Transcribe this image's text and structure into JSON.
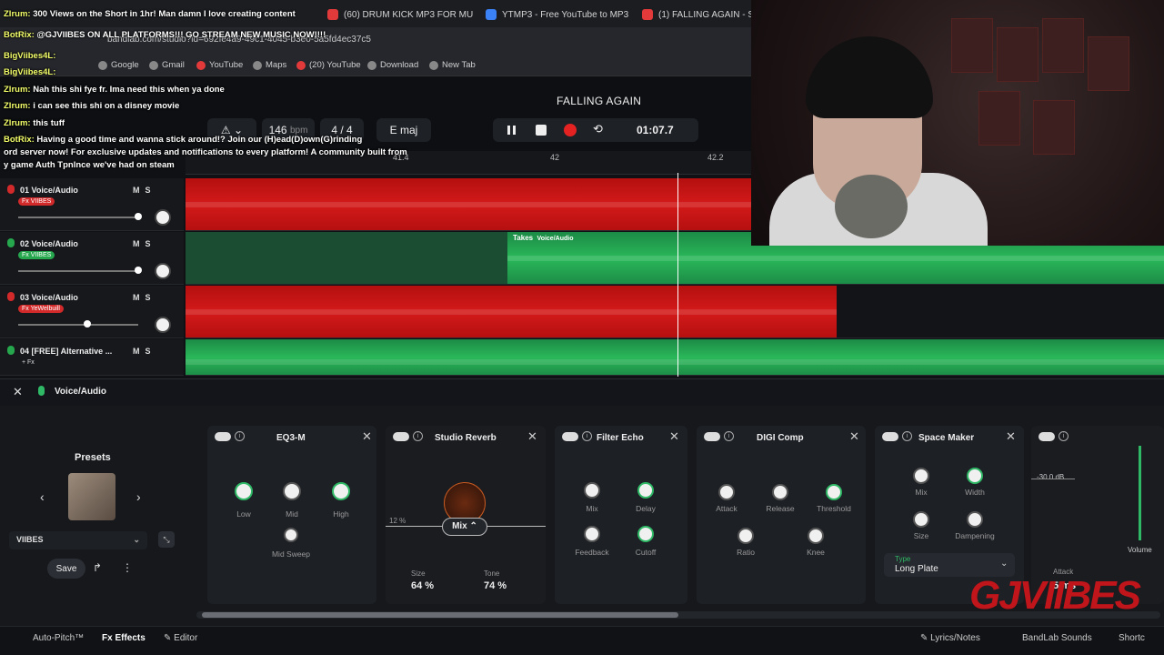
{
  "browser": {
    "tabs": [
      {
        "label": "(60) DRUM KICK MP3 FOR MU",
        "icon": "youtube-icon"
      },
      {
        "label": "YTMP3 - Free YouTube to MP3",
        "icon": "ytmp3-icon"
      },
      {
        "label": "(1) FALLING AGAIN - Studio",
        "icon": "bandlab-icon"
      }
    ],
    "url": "bandlab.com/studio?id=692fe4a9-49c1-4045-b3e0-5a5fd4ec37c5",
    "bookmarks": [
      "Google",
      "Gmail",
      "YouTube",
      "Maps",
      "(20) YouTube",
      "Download",
      "New Tab"
    ]
  },
  "studio": {
    "song_title": "FALLING AGAIN",
    "bpm": "146",
    "bpm_unit": "bpm",
    "time_sig": "4 / 4",
    "key": "E maj",
    "time": "01:07.7",
    "ruler_ticks": [
      "41.4",
      "42",
      "42.2"
    ]
  },
  "tracks": [
    {
      "name": "01  Voice/Audio",
      "fx": "Fx VIIBES",
      "fx_color": "red"
    },
    {
      "name": "02  Voice/Audio",
      "fx": "Fx VIIBES",
      "fx_color": "green",
      "take_label": "Takes",
      "take_sub": "Voice/Audio"
    },
    {
      "name": "03  Voice/Audio",
      "fx": "Fx YeWelbuill",
      "fx_color": "red"
    },
    {
      "name": "04  [FREE] Alternative ...",
      "fx": "+ Fx",
      "fx_color": "none"
    }
  ],
  "track_controls": {
    "mute": "M",
    "solo": "S"
  },
  "effects_panel": {
    "track_label": "Voice/Audio",
    "presets_title": "Presets",
    "preset_name": "VIIBES",
    "save_label": "Save",
    "plugins": {
      "eq": {
        "title": "EQ3-M",
        "knobs": [
          "Low",
          "Mid",
          "High",
          "Mid Sweep"
        ]
      },
      "reverb": {
        "title": "Studio Reverb",
        "mix_label": "Mix",
        "mix_pct": "12 %",
        "size_label": "Size",
        "size_val": "64 %",
        "tone_label": "Tone",
        "tone_val": "74 %"
      },
      "echo": {
        "title": "Filter Echo",
        "knobs": [
          "Mix",
          "Delay",
          "Feedback",
          "Cutoff"
        ]
      },
      "comp": {
        "title": "DIGI Comp",
        "knobs": [
          "Attack",
          "Release",
          "Threshold",
          "Ratio",
          "Knee"
        ]
      },
      "space": {
        "title": "Space Maker",
        "knobs": [
          "Mix",
          "Width",
          "Size",
          "Dampening"
        ],
        "type_label": "Type",
        "type_value": "Long Plate"
      },
      "limiter": {
        "db": "-30.0 dB",
        "attack_label": "Attack",
        "attack_val": "5 ms",
        "volume_label": "Volume"
      }
    }
  },
  "bottom_bar": {
    "autopitch": "Auto-Pitch™",
    "effects": "Effects",
    "editor": "Editor",
    "lyrics": "Lyrics/Notes",
    "sounds": "BandLab Sounds",
    "shortcuts": "Shortc"
  },
  "chat": [
    {
      "user": "Zlrum:",
      "msg": "300 Views on the Short in 1hr! Man damn I love creating content"
    },
    {
      "user": "BotRix:",
      "msg": "@GJVIIBES ON ALL PLATFORMS!!! GO STREAM NEW MUSIC NOW!!!!"
    },
    {
      "user": "BigViibes4L:",
      "msg": ""
    },
    {
      "user": "BigViibes4L:",
      "msg": ""
    },
    {
      "user": "Zlrum:",
      "msg": "Nah this shi fye fr. Ima need this when ya done"
    },
    {
      "user": "Zlrum:",
      "msg": "i can see this shi on a disney movie"
    },
    {
      "user": "Zlrum:",
      "msg": "this tuff"
    },
    {
      "user": "BotRix:",
      "msg": "Having a good time and wanna stick around!? Join our (H)ead(D)own(G)rinding"
    },
    {
      "user": "",
      "msg": "ord server now! For exclusive updates and notifications to every platform! A community built from"
    },
    {
      "user": "",
      "msg": "y game Auth Tpnlnce we've had on steam"
    }
  ],
  "watermark": "GJVIIBES",
  "colors": {
    "red_clip": "#d41a1a",
    "green_clip": "#2ab85a",
    "accent_green": "#2fb865"
  }
}
